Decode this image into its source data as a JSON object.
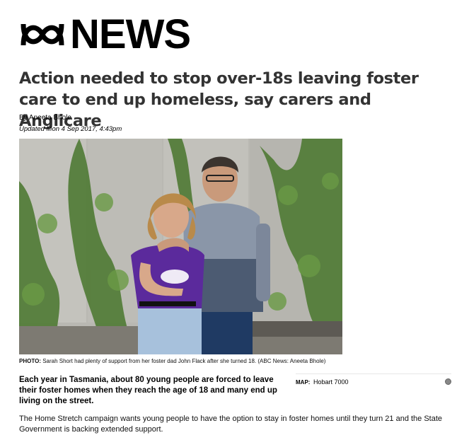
{
  "masthead": {
    "brand": "NEWS",
    "logo_icon": "abc-lissajous-logo"
  },
  "article": {
    "headline": "Action needed to stop over-18s leaving foster care to end up homeless, say carers and Anglicare",
    "byline": "By Aneeta Bhole",
    "updated": "Updated Mon 4 Sep 2017, 4:43pm",
    "photo": {
      "label": "PHOTO:",
      "caption": "Sarah Short had plenty of support from her foster dad John Flack after she turned 18.",
      "credit": "(ABC News: Aneeta Bhole)"
    },
    "lead": "Each year in Tasmania, about 80 young people are forced to leave their foster homes when they reach the age of 18 and many end up living on the street.",
    "map": {
      "label": "MAP:",
      "value": "Hobart 7000"
    },
    "body": "The Home Stretch campaign wants young people to have the option to stay in foster homes until they turn 21 and the State Government is backing extended support."
  },
  "colors": {
    "headline": "#333333",
    "text": "#000000"
  }
}
